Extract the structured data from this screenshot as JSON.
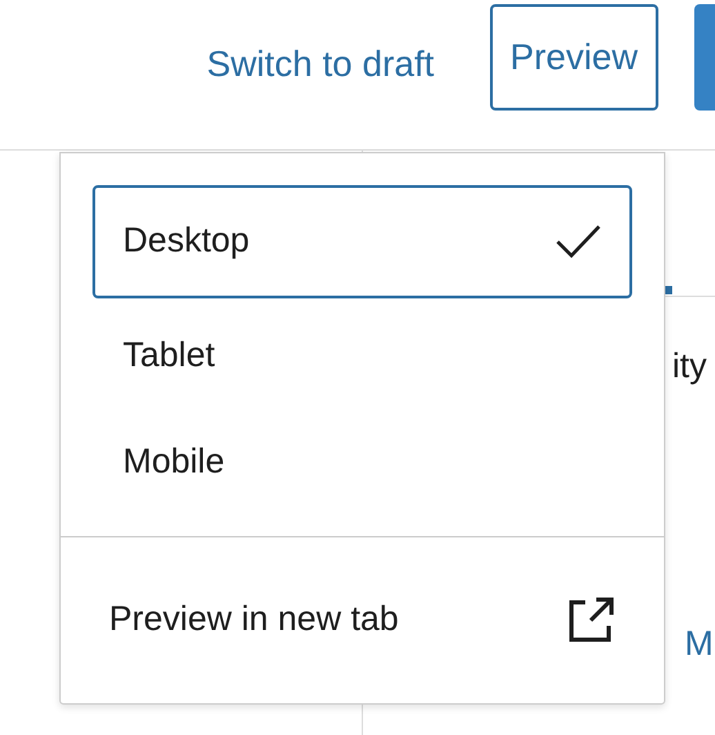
{
  "header": {
    "switch_link": "Switch to draft",
    "preview_button": {
      "label": "Preview",
      "expanded": true
    }
  },
  "sidebar": {
    "text_fragment": "ity",
    "link_fragment": "M"
  },
  "preview_menu": {
    "devices": [
      {
        "label": "Desktop",
        "selected": true
      },
      {
        "label": "Tablet",
        "selected": false
      },
      {
        "label": "Mobile",
        "selected": false
      }
    ],
    "new_tab": "Preview in new tab"
  }
}
